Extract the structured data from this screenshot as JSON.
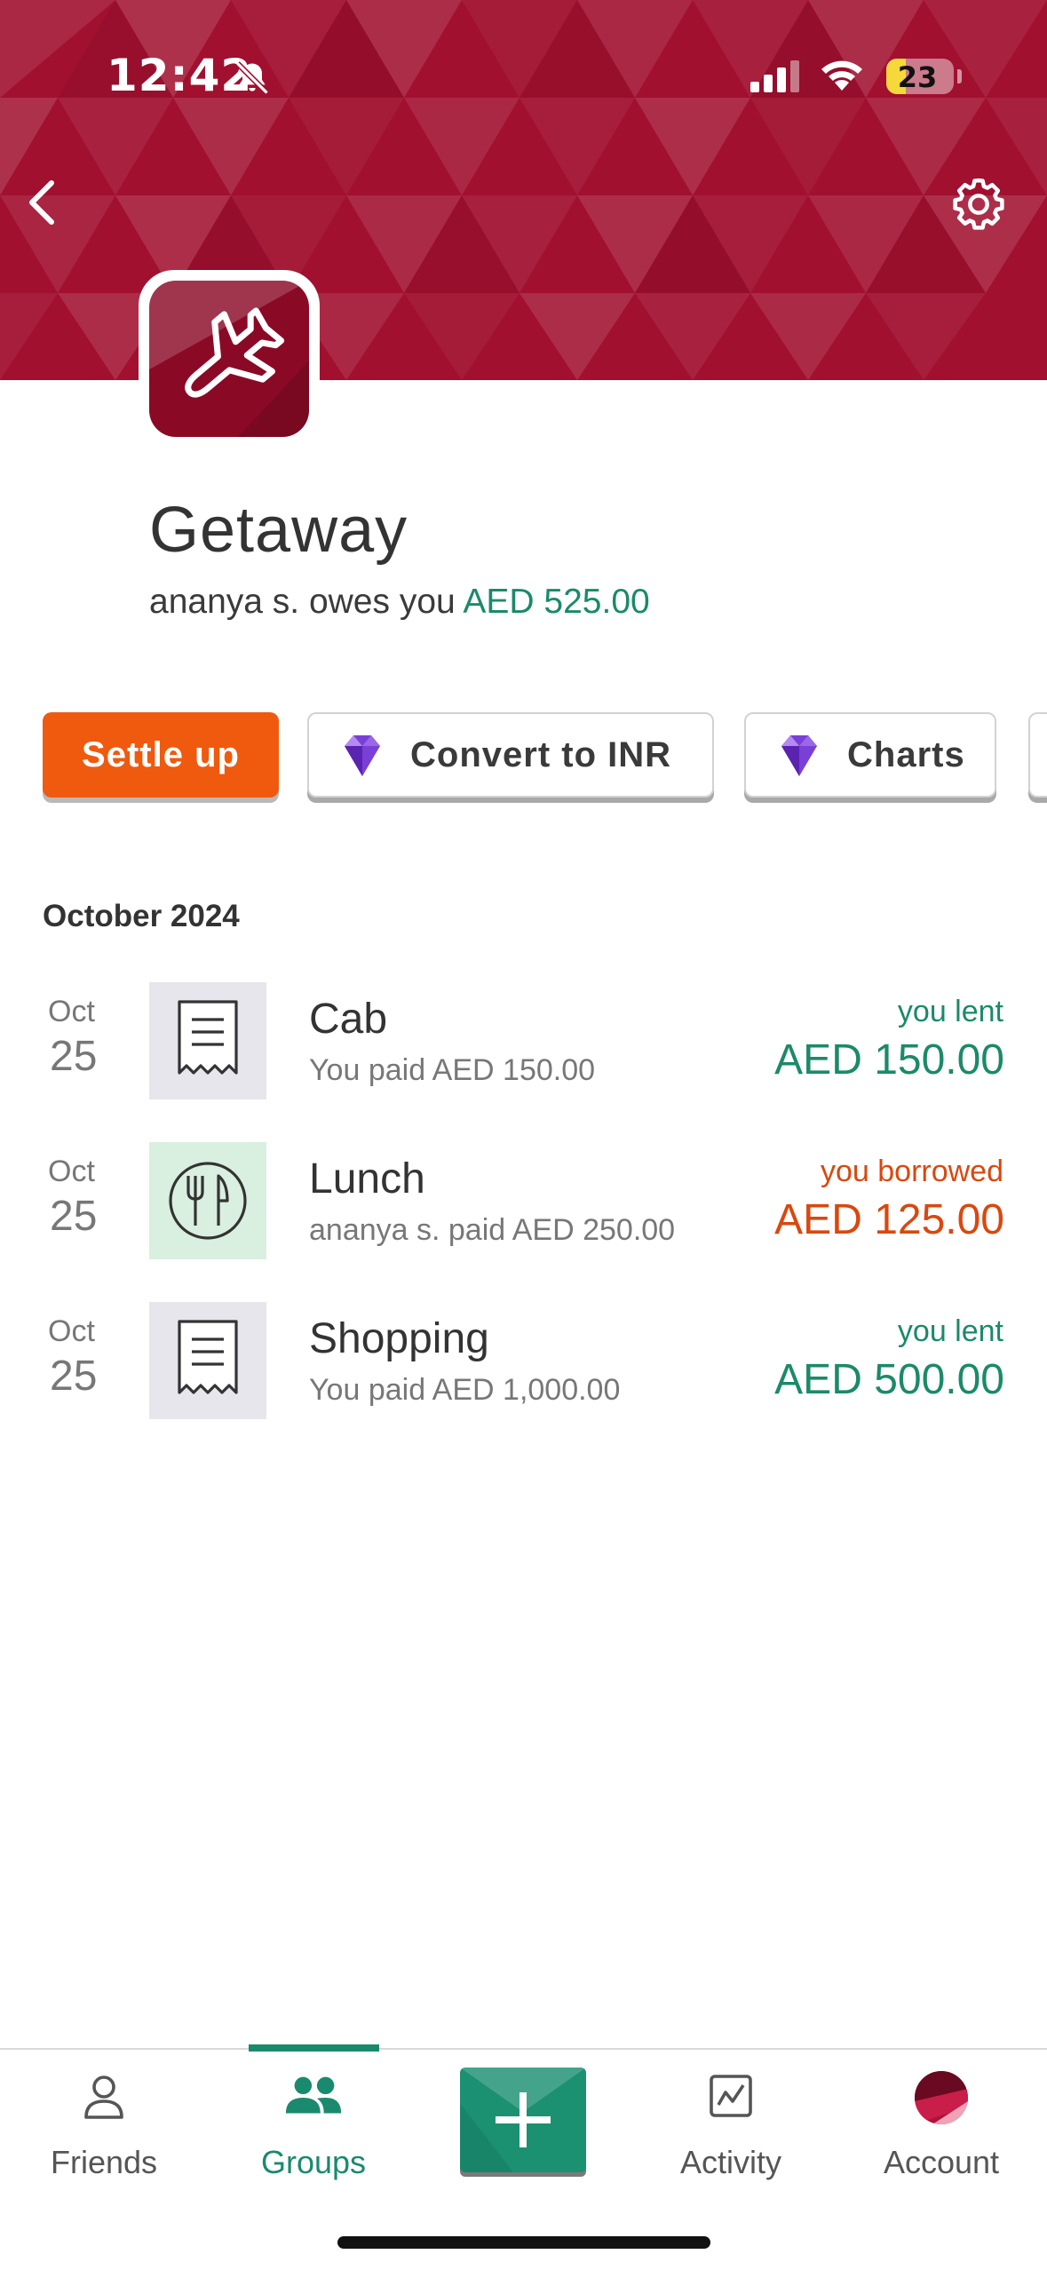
{
  "status_bar": {
    "time": "12:42",
    "battery": "23",
    "icons": [
      "bell-slash-icon",
      "cellular-signal-icon",
      "wifi-icon",
      "battery-icon"
    ]
  },
  "header": {
    "back_icon": "chevron-left-icon",
    "settings_icon": "gear-icon",
    "banner_color": "#a1102f",
    "group_icon": "airplane-icon"
  },
  "group": {
    "name": "Getaway",
    "balance_prefix": "ananya s. owes you",
    "balance_amount": "AED 525.00"
  },
  "actions": [
    {
      "label": "Settle up",
      "style": "primary"
    },
    {
      "label": "Convert to INR",
      "icon": "gem-icon"
    },
    {
      "label": "Charts",
      "icon": "gem-icon"
    }
  ],
  "expenses": {
    "section_header": "October 2024",
    "items": [
      {
        "month": "Oct",
        "day": "25",
        "icon": "receipt-icon",
        "title": "Cab",
        "subtitle": "You paid AED 150.00",
        "status": "you lent",
        "amount": "AED 150.00",
        "type": "lent"
      },
      {
        "month": "Oct",
        "day": "25",
        "icon": "plate-fork-knife-icon",
        "title": "Lunch",
        "subtitle": "ananya s. paid AED 250.00",
        "status": "you borrowed",
        "amount": "AED 125.00",
        "type": "borrowed"
      },
      {
        "month": "Oct",
        "day": "25",
        "icon": "receipt-icon",
        "title": "Shopping",
        "subtitle": "You paid AED 1,000.00",
        "status": "you lent",
        "amount": "AED 500.00",
        "type": "lent"
      }
    ]
  },
  "colors": {
    "lent": "#1b8a68",
    "borrowed": "#d9480f",
    "accent": "#1a8a6e",
    "settle": "#ef5a0f"
  },
  "tabbar": {
    "active": "Groups",
    "tabs": [
      {
        "label": "Friends",
        "icon": "person-icon"
      },
      {
        "label": "Groups",
        "icon": "people-icon"
      },
      {
        "label": "",
        "icon": "plus-icon"
      },
      {
        "label": "Activity",
        "icon": "activity-chart-icon"
      },
      {
        "label": "Account",
        "icon": "account-avatar-icon"
      }
    ]
  }
}
